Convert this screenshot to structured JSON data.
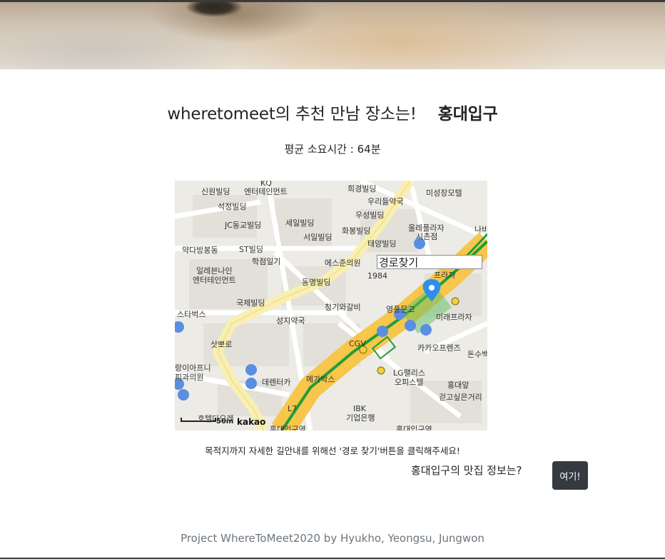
{
  "header": {
    "brand": "wheretomeet",
    "title_suffix": "의 추천 만남 장소는!",
    "place": "홍대입구"
  },
  "average_time": "평균 소요시간 : 64분",
  "map": {
    "route_button": "경로찾기",
    "scale_label": "50m",
    "provider": "kakao",
    "labels": {
      "l1": "신원빌딩",
      "l2": "엔터테인먼트",
      "l3": "KQ",
      "l4": "희경빌딩",
      "l5": "미성장모텔",
      "l6": "우리들약국",
      "l7": "석정빌딩",
      "l8": "우성빌딩",
      "l9": "JC동교빌딩",
      "l10": "세일빌딩",
      "l11": "올레플라자",
      "l12": "시촌점",
      "l13": "화봉빌딩",
      "l14": "서일빌딩",
      "l15": "태양빌딩",
      "l16": "약다방봉동",
      "l17": "ST빌딩",
      "l18": "학점일기",
      "l19": "에스준의원",
      "l20": "1984",
      "l21": "일레븐나인",
      "l22": "엔터테인먼트",
      "l23": "동명빌딩",
      "l24": "프라자",
      "l25": "국제빌딩",
      "l26": "청기와갈비",
      "l27": "영풍문고",
      "l28": "미래프라자",
      "l29": "스타벅스",
      "l30": "성지약국",
      "l31": "삿뽀로",
      "l32": "CGV",
      "l33": "카카오프렌즈",
      "l34": "돈수백",
      "l35": "랑이아프니",
      "l36": "피과의원",
      "l37": "데렌터카",
      "l38": "메가박스",
      "l39": "LG팰리스",
      "l40": "오피스텔",
      "l41": "홍대앞",
      "l42": "걷고싶은거리",
      "l43": "L7",
      "l44": "IBK",
      "l45": "기업은행",
      "l46": "호텔다오레",
      "l47": "홍대입구역",
      "l48": "나비",
      "l49": "홍대입구역"
    }
  },
  "guide_text": "목적지까지 자세한 길안내를 위해선 '경로 찾기'버튼을 클릭해주세요!",
  "food": {
    "question": "홍대입구의 맛집 정보는?",
    "button": "여기!"
  },
  "footer": "Project WhereToMeet2020 by Hyukho, Yeongsu, Jungwon",
  "colors": {
    "button_bg": "#343a40",
    "footer_text": "#6c757d",
    "subway_line": "#1e9e3a",
    "road_major": "#f7c64a",
    "road_minor": "#f9efb0"
  }
}
